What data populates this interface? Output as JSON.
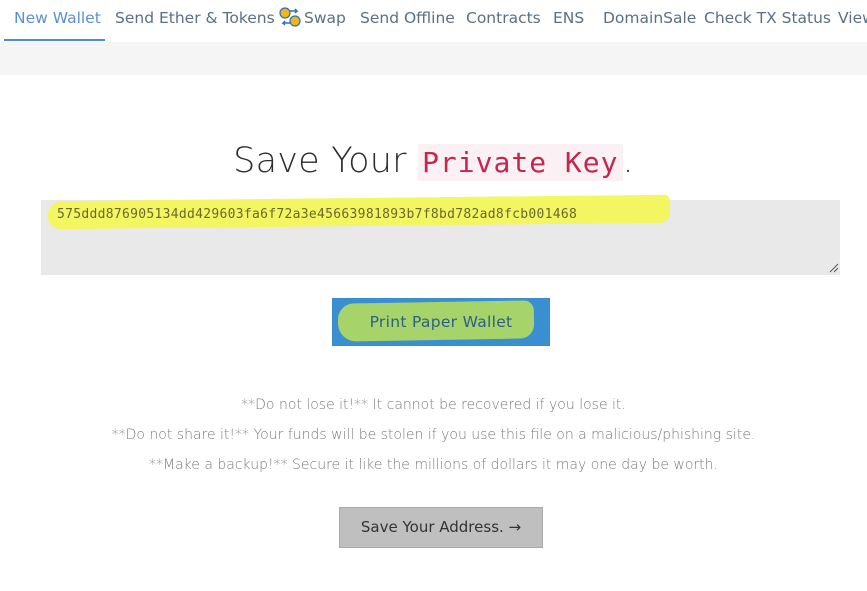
{
  "nav": {
    "items": [
      {
        "label": "New Wallet"
      },
      {
        "label": "Send Ether & Tokens"
      },
      {
        "label": "Swap",
        "icon": "swap-icon"
      },
      {
        "label": "Send Offline"
      },
      {
        "label": "Contracts"
      },
      {
        "label": "ENS"
      },
      {
        "label": "DomainSale"
      },
      {
        "label": "Check TX Status"
      },
      {
        "label": "View"
      }
    ],
    "active": "New Wallet"
  },
  "heading": {
    "prefix": "Save Your",
    "code": "Private Key",
    "suffix": "."
  },
  "private_key": {
    "value": "575ddd876905134dd429603fa6f72a3e45663981893b7f8bd782ad8fcb001468"
  },
  "print_button": {
    "label": "Print Paper Wallet"
  },
  "warnings": [
    "**Do not lose it!** It cannot be recovered if you lose it.",
    "**Do not share it!** Your funds will be stolen if you use this file on a malicious/phishing site.",
    "**Make a backup!** Secure it like the millions of dollars it may one day be worth."
  ],
  "save_address_button": {
    "label": "Save Your Address. →"
  },
  "colors": {
    "accent": "#4a8ed8",
    "nav_text": "#5b6f86",
    "code_text": "#c7254e",
    "highlight_yellow": "#f3f55a",
    "highlight_green": "#a6d36a",
    "print_button_bg": "#3a8fd0",
    "save_button_bg": "#bfbfbf"
  }
}
